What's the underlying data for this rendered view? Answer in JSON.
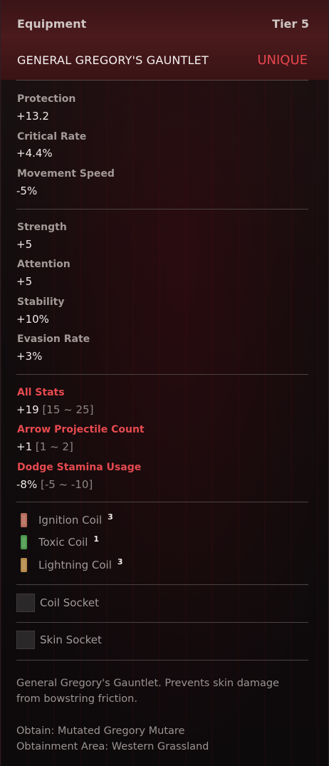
{
  "header": {
    "category": "Equipment",
    "tier": "Tier 5",
    "item_name": "GENERAL GREGORY'S GAUNTLET",
    "rarity": "UNIQUE"
  },
  "base_stats": [
    {
      "label": "Protection",
      "value": "+13.2"
    },
    {
      "label": "Critical Rate",
      "value": "+4.4%"
    },
    {
      "label": "Movement Speed",
      "value": "-5%"
    }
  ],
  "attributes": [
    {
      "label": "Strength",
      "value": "+5"
    },
    {
      "label": "Attention",
      "value": "+5"
    },
    {
      "label": "Stability",
      "value": "+10%"
    },
    {
      "label": "Evasion Rate",
      "value": "+3%"
    }
  ],
  "unique_stats": [
    {
      "label": "All Stats",
      "value": "+19",
      "range": "[15 ~ 25]"
    },
    {
      "label": "Arrow Projectile Count",
      "value": "+1",
      "range": "[1 ~ 2]"
    },
    {
      "label": "Dodge Stamina Usage",
      "value": "-8%",
      "range": "[-5 ~ -10]"
    }
  ],
  "coils": [
    {
      "name": "Ignition Coil",
      "level": "3",
      "color": "#b56a5a",
      "icon": "ignition-coil-icon"
    },
    {
      "name": "Toxic Coil",
      "level": "1",
      "color": "#4c9a4e",
      "icon": "toxic-coil-icon"
    },
    {
      "name": "Lightning Coil",
      "level": "3",
      "color": "#b58a4c",
      "icon": "lightning-coil-icon"
    }
  ],
  "sockets": [
    {
      "label": "Coil Socket"
    },
    {
      "label": "Skin Socket"
    }
  ],
  "description": {
    "line1": "General Gregory's Gauntlet. Prevents skin damage",
    "line2": "from bowstring friction.",
    "obtain": "Obtain: Mutated Gregory Mutare",
    "area": "Obtainment Area: Western Grassland"
  }
}
